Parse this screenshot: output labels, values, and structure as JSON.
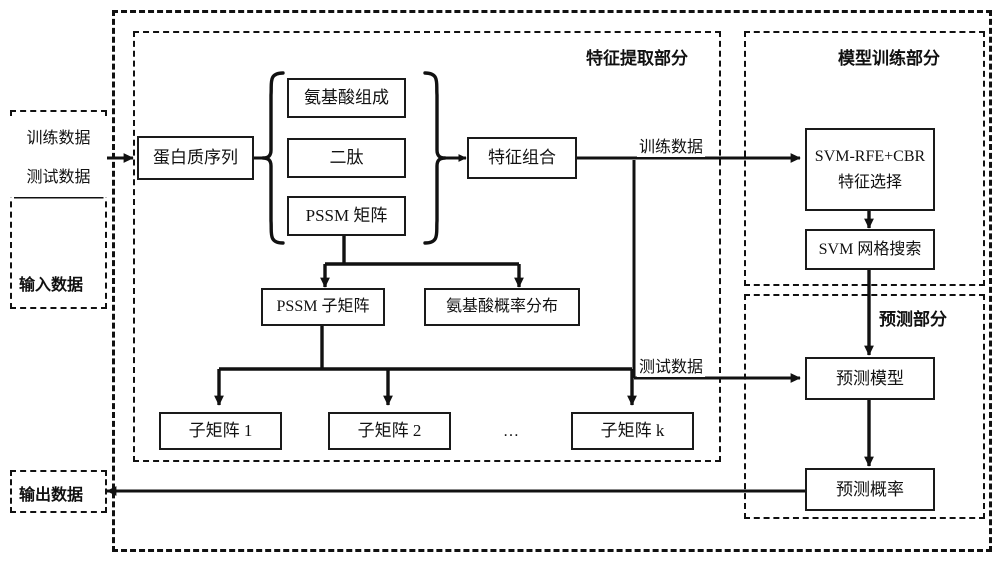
{
  "diagram": {
    "title_hidden": "",
    "groups": [
      {
        "id": "pipeline",
        "label": ""
      },
      {
        "id": "feature_extraction",
        "label": "特征提取部分"
      },
      {
        "id": "model_training",
        "label": "模型训练部分"
      },
      {
        "id": "prediction",
        "label": "预测部分"
      },
      {
        "id": "input_data",
        "label": "输入数据"
      },
      {
        "id": "output_data",
        "label": "输出数据"
      }
    ],
    "nodes": {
      "train_data": "训练数据",
      "test_data": "测试数据",
      "input_data": "输入数据",
      "output_data": "输出数据",
      "protein_sequence": "蛋白质序列",
      "aac": "氨基酸组成",
      "dipeptide": "二肽",
      "pssm_matrix": "PSSM 矩阵",
      "feature_combination": "特征组合",
      "pssm_submatrix": "PSSM 子矩阵",
      "aa_prob_dist": "氨基酸概率分布",
      "submatrix_1": "子矩阵 1",
      "submatrix_2": "子矩阵 2",
      "submatrix_k": "子矩阵 k",
      "submatrix_ellipsis": "…",
      "svm_rfe_cbr_line1": "SVM-RFE+CBR",
      "svm_rfe_cbr_line2": "特征选择",
      "svm_grid_search": "SVM 网格搜索",
      "prediction_model": "预测模型",
      "prediction_probability": "预测概率"
    },
    "edge_labels": {
      "training_data": "训练数据",
      "test_data": "测试数据"
    },
    "colors": {
      "line": "#111111",
      "box_border": "#1a1a1a",
      "background": "#ffffff"
    }
  }
}
